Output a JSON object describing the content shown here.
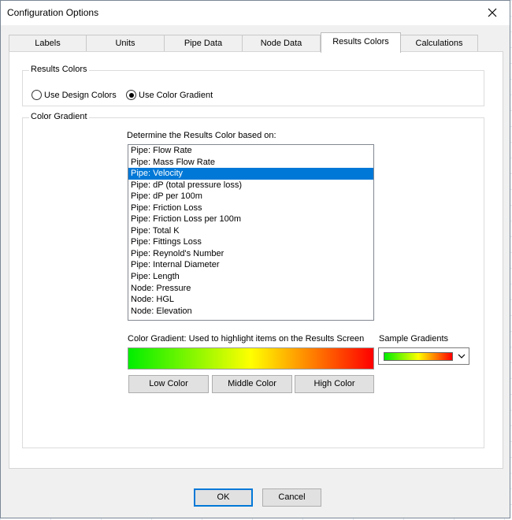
{
  "window": {
    "title": "Configuration Options"
  },
  "tabs": [
    {
      "label": "Labels"
    },
    {
      "label": "Units"
    },
    {
      "label": "Pipe Data"
    },
    {
      "label": "Node Data"
    },
    {
      "label": "Results Colors"
    },
    {
      "label": "Calculations"
    }
  ],
  "active_tab": "Results Colors",
  "results_colors": {
    "group_label": "Results Colors",
    "radio_design": "Use Design Colors",
    "radio_gradient": "Use Color Gradient",
    "selected_option": "Use Color Gradient"
  },
  "color_gradient": {
    "group_label": "Color Gradient",
    "list_heading": "Determine the Results Color based on:",
    "list_items": [
      "Pipe: Flow Rate",
      "Pipe: Mass Flow Rate",
      "Pipe: Velocity",
      "Pipe: dP (total pressure loss)",
      "Pipe: dP per 100m",
      "Pipe: Friction Loss",
      "Pipe: Friction Loss per 100m",
      "Pipe: Total K",
      "Pipe: Fittings Loss",
      "Pipe: Reynold's Number",
      "Pipe: Internal Diameter",
      "Pipe: Length",
      "Node: Pressure",
      "Node: HGL",
      "Node: Elevation"
    ],
    "selected_item": "Pipe: Velocity",
    "gradient_caption": "Color Gradient: Used to highlight items on the Results Screen",
    "sample_label": "Sample Gradients",
    "low_button": "Low Color",
    "middle_button": "Middle Color",
    "high_button": "High Color",
    "gradient_colors": {
      "low": "#00ee00",
      "middle": "#ffff00",
      "high": "#ff0000"
    }
  },
  "footer": {
    "ok": "OK",
    "cancel": "Cancel"
  },
  "colors": {
    "selection": "#0078d7",
    "dialog_bg": "#f0f0f0",
    "default_border": "#0078d7"
  },
  "icons": {
    "close": "close-icon",
    "dropdown": "chevron-down-icon"
  }
}
